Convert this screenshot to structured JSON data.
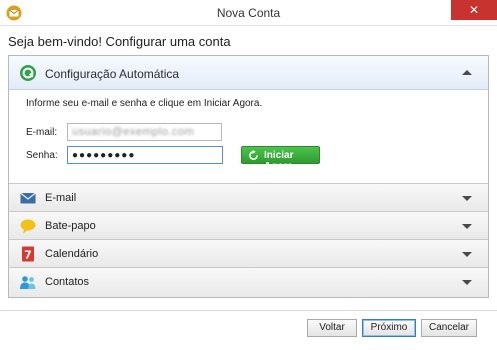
{
  "window": {
    "title": "Nova Conta",
    "close_glyph": "✕"
  },
  "welcome": "Seja bem-vindo! Configurar uma conta",
  "auto_config": {
    "label": "Configuração Automática",
    "instruction": "Informe seu e-mail e senha e clique em Iniciar Agora.",
    "email_label": "E-mail:",
    "email_value": "usuario@exemplo.com",
    "password_label": "Senha:",
    "password_value": "●●●●●●●●●",
    "start_button": "Iniciar Agora"
  },
  "sections": [
    {
      "label": "E-mail",
      "icon": "envelope-icon"
    },
    {
      "label": "Bate-papo",
      "icon": "chat-bubble-icon"
    },
    {
      "label": "Calendário",
      "icon": "calendar-icon"
    },
    {
      "label": "Contatos",
      "icon": "contacts-icon"
    }
  ],
  "calendar_icon_text": "7",
  "buttons": {
    "back": "Voltar",
    "next": "Próximo",
    "cancel": "Cancelar"
  },
  "colors": {
    "close": "#c7332f",
    "start_button": "#3aab3a",
    "accent": "#5a8fd1"
  }
}
